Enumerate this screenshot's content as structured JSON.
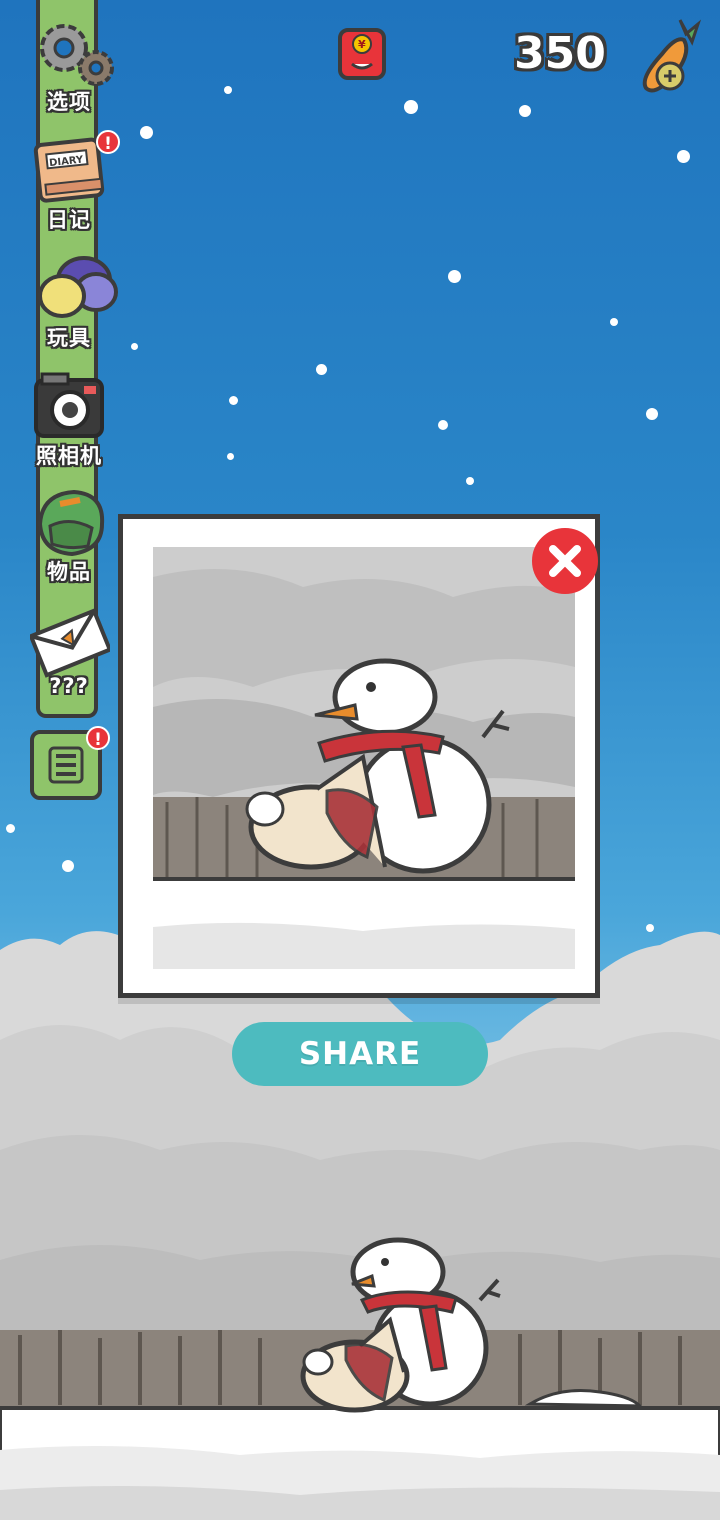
{
  "hud": {
    "carrot_count": "350",
    "icons": {
      "red_envelope": "red-envelope-icon",
      "carrot_add": "carrot-plus-icon",
      "menu": "menu-list-icon"
    }
  },
  "sidebar": {
    "items": [
      {
        "label": "选项",
        "icon": "gear-icon",
        "alert": ""
      },
      {
        "label": "日记",
        "icon": "diary-book-icon",
        "alert": "!"
      },
      {
        "label": "玩具",
        "icon": "toy-balls-icon",
        "alert": ""
      },
      {
        "label": "照相机",
        "icon": "camera-icon",
        "alert": ""
      },
      {
        "label": "物品",
        "icon": "backpack-icon",
        "alert": ""
      },
      {
        "label": "???",
        "icon": "letter-envelope-icon",
        "alert": ""
      }
    ],
    "menu_alert": "!"
  },
  "photo_dialog": {
    "share_label": "SHARE",
    "close_icon": "close-x-icon",
    "subject": "rabbit-and-snowman-photo"
  },
  "colors": {
    "sky_top": "#1f74be",
    "rail_green": "#8fc46a",
    "close_red": "#e8343a",
    "share_teal": "#4dbbbf",
    "snow_grey": "#d7d7d7"
  }
}
